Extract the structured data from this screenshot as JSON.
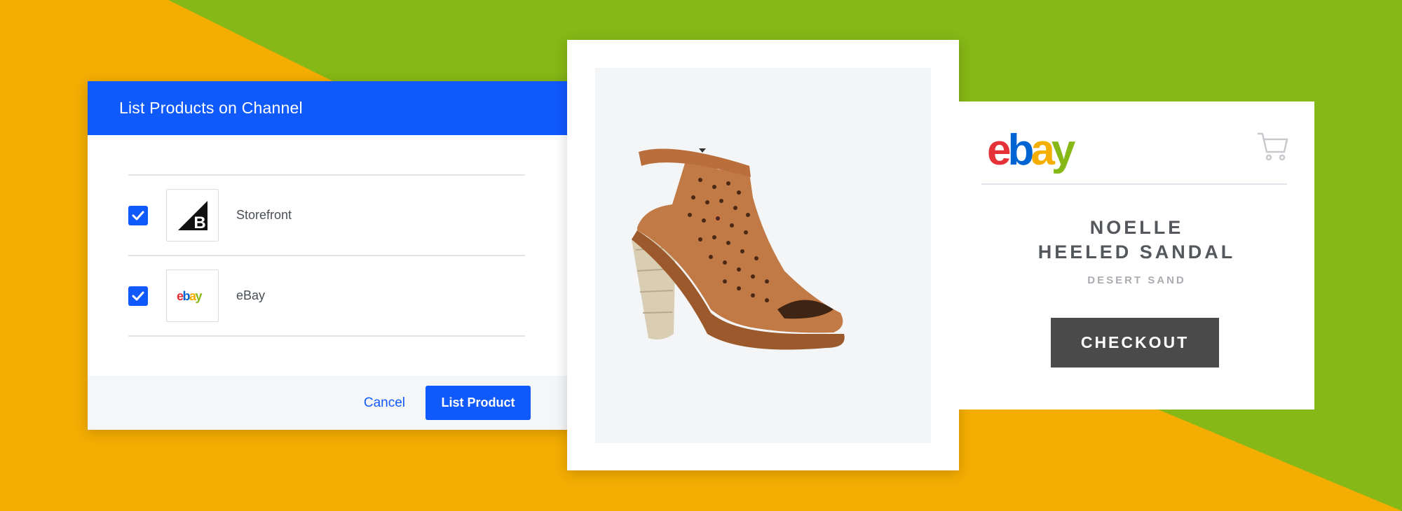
{
  "colors": {
    "orange": "#f4ad02",
    "green": "#86b817",
    "accent_blue": "#1059fb",
    "checkout_bg": "#4a4a4a"
  },
  "dialog": {
    "title": "List Products on Channel",
    "channels": [
      {
        "label": "Storefront",
        "checked": true,
        "logo": "bigcommerce-logo"
      },
      {
        "label": "eBay",
        "checked": true,
        "logo": "ebay-logo"
      }
    ],
    "cancel_label": "Cancel",
    "submit_label": "List Product"
  },
  "product_preview": {
    "image": "sandal-photo"
  },
  "ebay_checkout": {
    "logo": "ebay",
    "product_name_line1": "NOELLE",
    "product_name_line2": "HEELED SANDAL",
    "variant": "DESERT SAND",
    "checkout_label": "CHECKOUT"
  }
}
